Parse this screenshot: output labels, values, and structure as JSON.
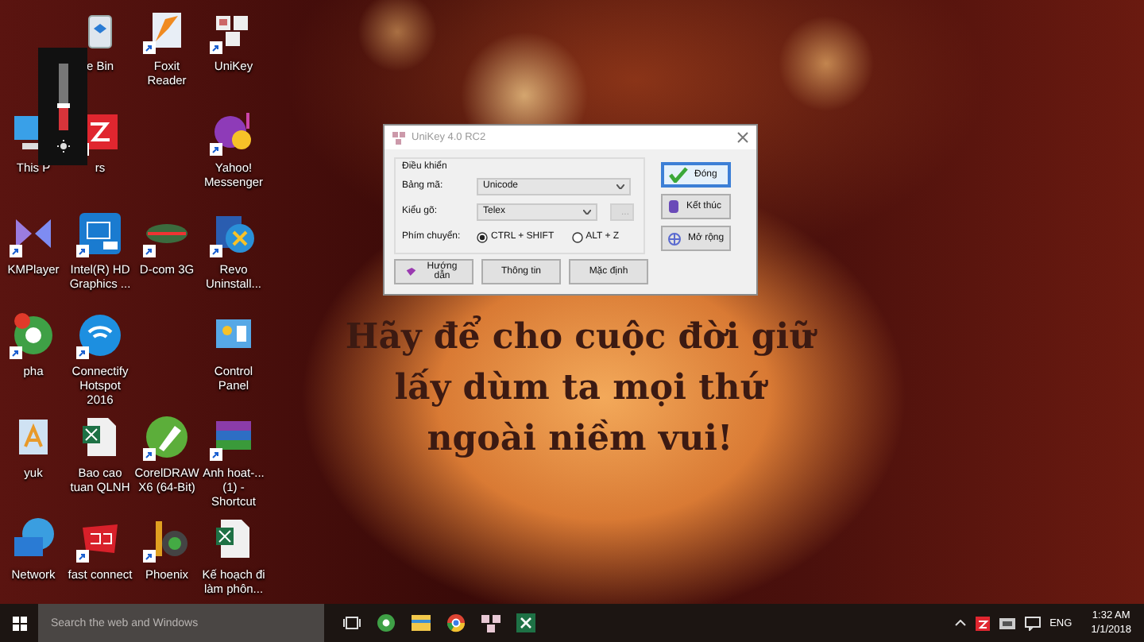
{
  "desktop_icons": [
    {
      "label": "e Bin",
      "shortcut": false
    },
    {
      "label": "Foxit Reader",
      "shortcut": true
    },
    {
      "label": "UniKey",
      "shortcut": true
    },
    {
      "label": "This P",
      "shortcut": false
    },
    {
      "label": "rs",
      "shortcut": true
    },
    {
      "label": "Yahoo! Messenger",
      "shortcut": true
    },
    {
      "label": "KMPlayer",
      "shortcut": true
    },
    {
      "label": "Intel(R) HD Graphics ...",
      "shortcut": true
    },
    {
      "label": "D-com 3G",
      "shortcut": true
    },
    {
      "label": "Revo Uninstall...",
      "shortcut": true
    },
    {
      "label": "pha",
      "shortcut": true
    },
    {
      "label": "Connectify Hotspot 2016",
      "shortcut": true
    },
    {
      "label": "Control Panel",
      "shortcut": false
    },
    {
      "label": "yuk",
      "shortcut": false
    },
    {
      "label": "Bao cao tuan QLNH",
      "shortcut": false
    },
    {
      "label": "CorelDRAW X6 (64-Bit)",
      "shortcut": true
    },
    {
      "label": "Anh hoat-... (1) - Shortcut",
      "shortcut": true
    },
    {
      "label": "Network",
      "shortcut": false
    },
    {
      "label": "fast connect",
      "shortcut": true
    },
    {
      "label": "Phoenix",
      "shortcut": true
    },
    {
      "label": "Kế hoạch đi làm phôn...",
      "shortcut": false
    }
  ],
  "volume_flyout": {
    "level": 0.35
  },
  "wallpaper_quote": [
    "Hãy để cho cuộc đời giữ",
    "lấy dùm ta mọi thứ",
    "ngoài niềm vui!"
  ],
  "dialog": {
    "title": "UniKey 4.0 RC2",
    "group_label": "Điều khiển",
    "fields": [
      {
        "label": "Bảng mã:",
        "value": "Unicode",
        "kind": "dropdown"
      },
      {
        "label": "Kiểu gõ:",
        "value": "Telex",
        "kind": "dropdown_with_button",
        "button": {
          "label": "...",
          "disabled": true
        }
      }
    ],
    "switch": {
      "label": "Phím chuyển:",
      "options": [
        {
          "label": "CTRL + SHIFT",
          "selected": true
        },
        {
          "label": "ALT + Z",
          "selected": false
        }
      ]
    },
    "side_buttons": [
      {
        "label": "Đóng",
        "focused": true
      },
      {
        "label": "Kết thúc",
        "focused": false
      },
      {
        "label": "Mở rộng",
        "focused": false
      }
    ],
    "bottom_buttons": [
      {
        "label": "Hướng dẫn"
      },
      {
        "label": "Thông tin"
      },
      {
        "label": "Mặc định"
      }
    ]
  },
  "taskbar": {
    "search": {
      "placeholder": "Search the web and Windows"
    },
    "tray": {
      "language": "ENG",
      "time": "1:32 AM",
      "date": "1/1/2018"
    }
  }
}
